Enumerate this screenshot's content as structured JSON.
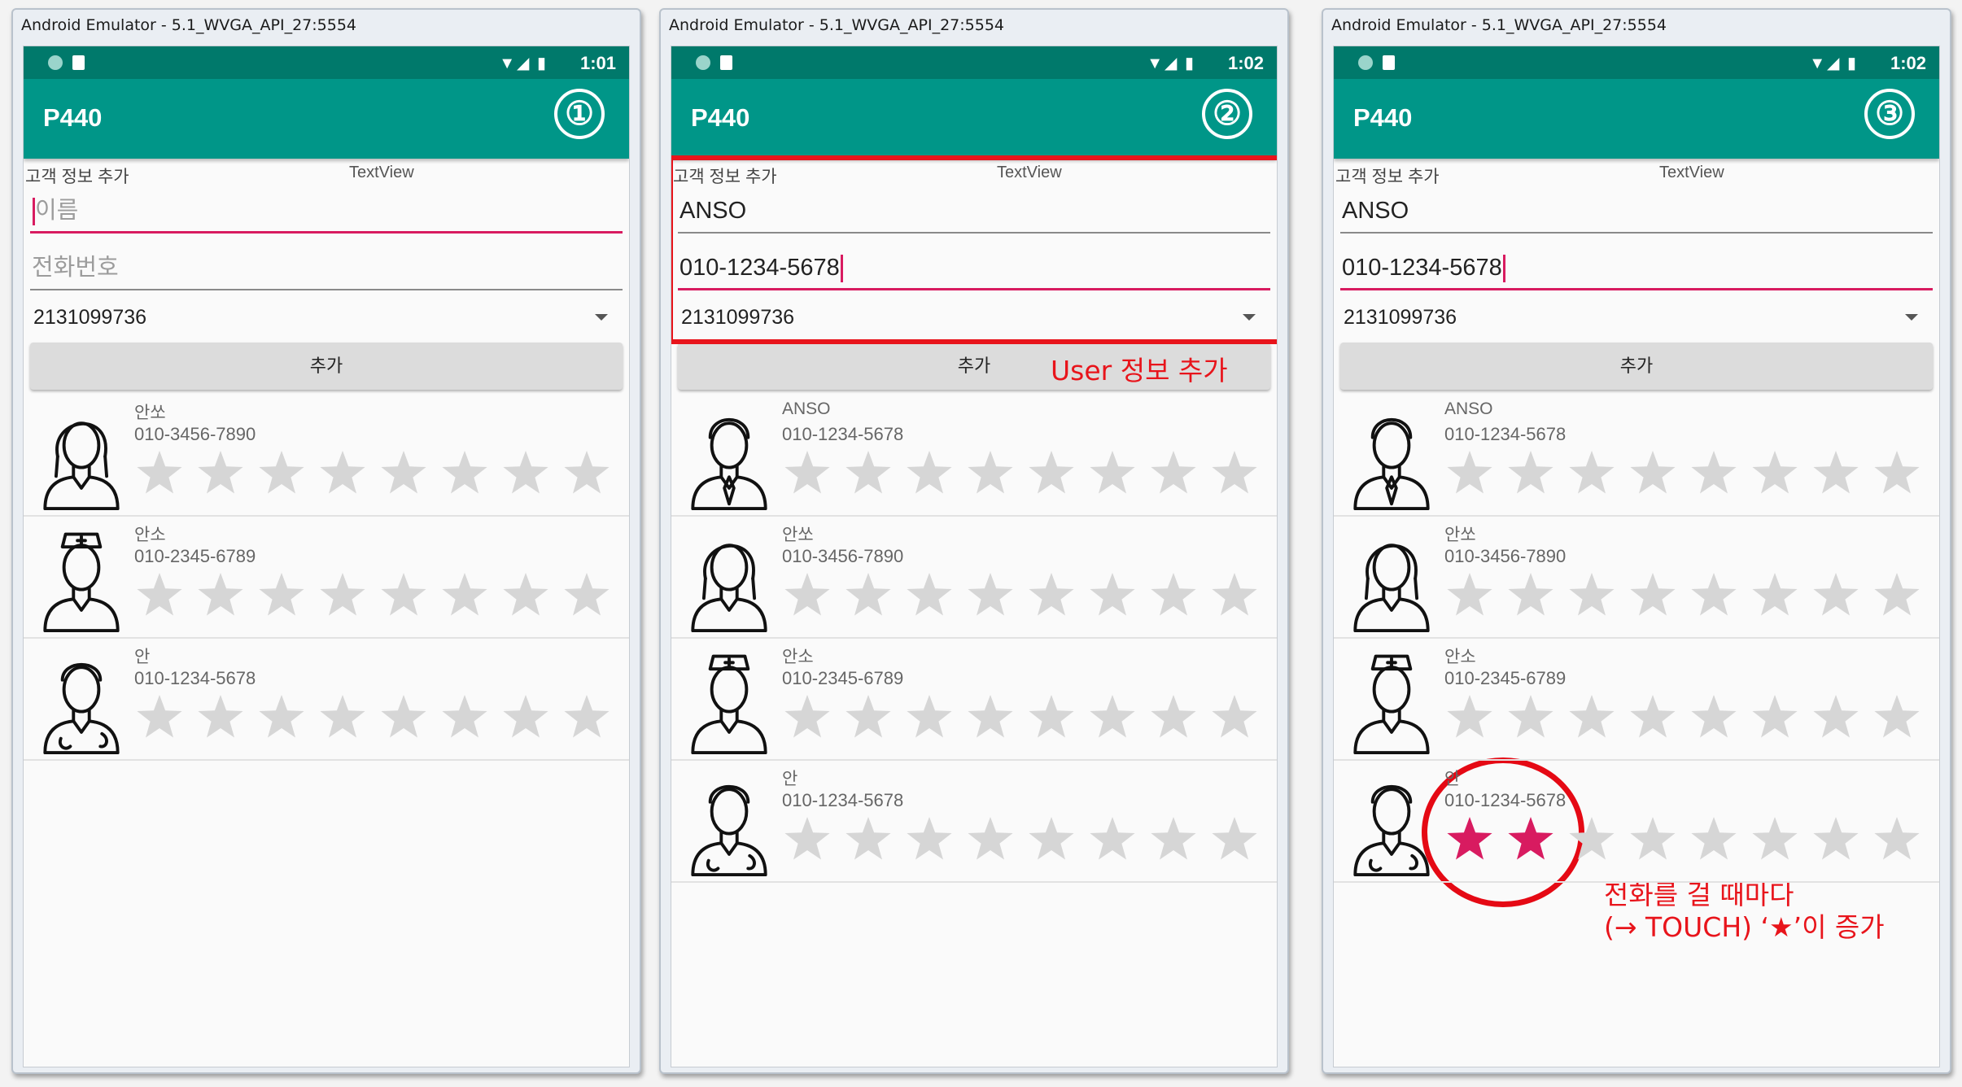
{
  "panels": [
    {
      "window_title": "Android Emulator - 5.1_WVGA_API_27:5554",
      "time": "1:01",
      "app_title": "P440",
      "step": "①",
      "form_label": "고객 정보 추가",
      "textview": "TextView",
      "name_value": "",
      "name_placeholder": "이름",
      "phone_value": "",
      "phone_placeholder": "전화번호",
      "spinner_value": "2131099736",
      "add_label": "추가",
      "contacts": [
        {
          "name": "안쏘",
          "phone": "010-3456-7890",
          "avatar": "woman-avatar-icon",
          "rating": 0
        },
        {
          "name": "안소",
          "phone": "010-2345-6789",
          "avatar": "nurse-avatar-icon",
          "rating": 0
        },
        {
          "name": "안",
          "phone": "010-1234-5678",
          "avatar": "doctor-avatar-icon",
          "rating": 0
        }
      ]
    },
    {
      "window_title": "Android Emulator - 5.1_WVGA_API_27:5554",
      "time": "1:02",
      "app_title": "P440",
      "step": "②",
      "form_label": "고객 정보 추가",
      "textview": "TextView",
      "name_value": "ANSO",
      "name_placeholder": "이름",
      "phone_value": "010-1234-5678",
      "phone_placeholder": "전화번호",
      "spinner_value": "2131099736",
      "add_label": "추가",
      "annotation": "User 정보 추가",
      "contacts": [
        {
          "name": "ANSO",
          "phone": "010-1234-5678",
          "avatar": "businessman-avatar-icon",
          "rating": 0
        },
        {
          "name": "안쏘",
          "phone": "010-3456-7890",
          "avatar": "woman-avatar-icon",
          "rating": 0
        },
        {
          "name": "안소",
          "phone": "010-2345-6789",
          "avatar": "nurse-avatar-icon",
          "rating": 0
        },
        {
          "name": "안",
          "phone": "010-1234-5678",
          "avatar": "doctor-avatar-icon",
          "rating": 0
        }
      ]
    },
    {
      "window_title": "Android Emulator - 5.1_WVGA_API_27:5554",
      "time": "1:02",
      "app_title": "P440",
      "step": "③",
      "form_label": "고객 정보 추가",
      "textview": "TextView",
      "name_value": "ANSO",
      "name_placeholder": "이름",
      "phone_value": "010-1234-5678",
      "phone_placeholder": "전화번호",
      "spinner_value": "2131099736",
      "add_label": "추가",
      "annotation_line1": "전화를 걸 때마다",
      "annotation_line2": "(→ TOUCH) ‘★’이 증가",
      "contacts": [
        {
          "name": "ANSO",
          "phone": "010-1234-5678",
          "avatar": "businessman-avatar-icon",
          "rating": 0
        },
        {
          "name": "안쏘",
          "phone": "010-3456-7890",
          "avatar": "woman-avatar-icon",
          "rating": 0
        },
        {
          "name": "안소",
          "phone": "010-2345-6789",
          "avatar": "nurse-avatar-icon",
          "rating": 0
        },
        {
          "name": "안",
          "phone": "010-1234-5678",
          "avatar": "doctor-avatar-icon",
          "rating": 2
        }
      ]
    }
  ],
  "max_stars": 8,
  "colors": {
    "appbar": "#009688",
    "statusbar": "#00796b",
    "star_empty": "#d6d6d6",
    "star_filled": "#d81b60",
    "annotation": "#e8141b"
  }
}
